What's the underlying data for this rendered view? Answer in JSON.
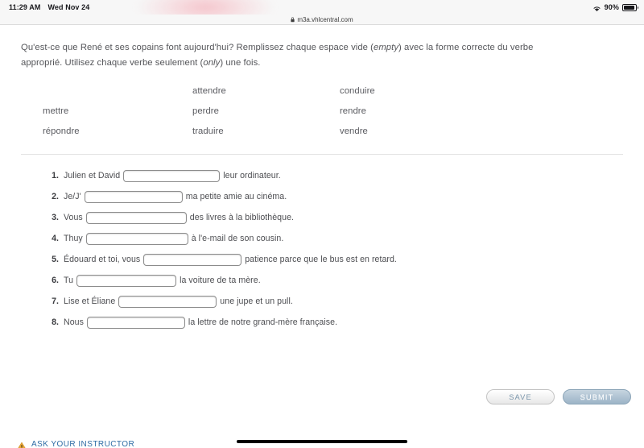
{
  "status_bar": {
    "time": "11:29 AM",
    "date": "Wed Nov 24",
    "battery_percent": "90%",
    "wifi_icon": "wifi-icon",
    "battery_icon": "battery-icon"
  },
  "browser": {
    "url": "m3a.vhlcentral.com",
    "lock_icon": "lock-icon"
  },
  "instructions": {
    "part1": "Qu'est-ce que René et ses copains font aujourd'hui? Remplissez chaque espace vide (",
    "em1": "empty",
    "part2": ") avec la forme correcte du verbe approprié. Utilisez chaque verbe seulement (",
    "em2": "only",
    "part3": ") une fois."
  },
  "verb_bank": {
    "rows": [
      [
        "",
        "attendre",
        "conduire"
      ],
      [
        "mettre",
        "perdre",
        "rendre"
      ],
      [
        "répondre",
        "traduire",
        "vendre"
      ]
    ]
  },
  "exercises": [
    {
      "num": "1.",
      "pre": "Julien et David ",
      "value": "",
      "post": " leur ordinateur.",
      "input_width": 120
    },
    {
      "num": "2.",
      "pre": "Je/J' ",
      "value": "",
      "post": " ma petite amie au cinéma.",
      "input_width": 122
    },
    {
      "num": "3.",
      "pre": "Vous ",
      "value": "",
      "post": " des livres à la bibliothèque.",
      "input_width": 125
    },
    {
      "num": "4.",
      "pre": "Thuy ",
      "value": "",
      "post": " à l'e-mail de son cousin.",
      "input_width": 127
    },
    {
      "num": "5.",
      "pre": "Édouard et toi, vous ",
      "value": "",
      "post": " patience parce que le bus est en retard.",
      "input_width": 122
    },
    {
      "num": "6.",
      "pre": "Tu ",
      "value": "",
      "post": " la voiture de ta mère.",
      "input_width": 124
    },
    {
      "num": "7.",
      "pre": "Lise et Éliane ",
      "value": "",
      "post": " une jupe et un pull.",
      "input_width": 122
    },
    {
      "num": "8.",
      "pre": "Nous ",
      "value": "",
      "post": " la lettre de notre grand-mère française.",
      "input_width": 122
    }
  ],
  "actions": {
    "save_label": "SAVE",
    "submit_label": "SUBMIT"
  },
  "ask_instructor": {
    "label": "ASK YOUR INSTRUCTOR",
    "icon": "warning-triangle-icon",
    "icon_color": "#e8a73a",
    "text_color": "#2e6ca4"
  }
}
